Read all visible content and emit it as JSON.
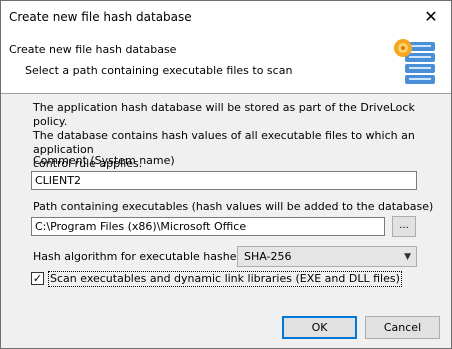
{
  "window": {
    "title": "Create new file hash database"
  },
  "header": {
    "title": "Create new file hash database",
    "subtitle": "Select a path containing executable files to scan",
    "icon": "database-gear-icon"
  },
  "body": {
    "description_line1": "The application hash database will be stored as part of the DriveLock policy.",
    "description_line2": "The database contains hash values of all executable files to which an application",
    "description_line3": "control rule applies.",
    "comment_label": "Comment (System name)",
    "comment_value": "CLIENT2",
    "path_label": "Path containing executables (hash values will be added to the database)",
    "path_value": "C:\\Program Files (x86)\\Microsoft Office",
    "browse_label": "...",
    "hash_label": "Hash algorithm for executable hashes",
    "hash_value": "SHA-256",
    "scan_checkbox_label": "Scan executables and dynamic link libraries (EXE and DLL files)",
    "scan_checked": true
  },
  "footer": {
    "ok_label": "OK",
    "cancel_label": "Cancel"
  },
  "colors": {
    "accent": "#0078d7",
    "dialog_bg": "#f0f0f0"
  }
}
